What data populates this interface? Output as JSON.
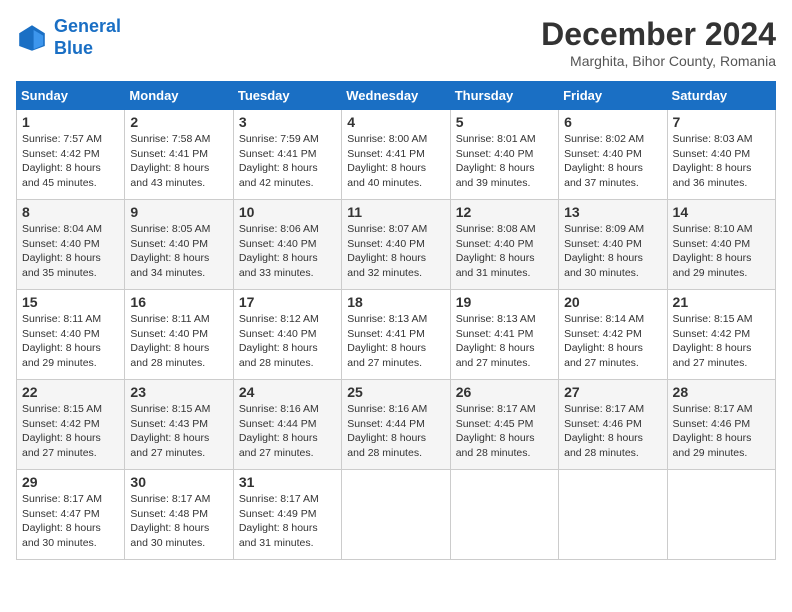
{
  "header": {
    "logo_line1": "General",
    "logo_line2": "Blue",
    "month": "December 2024",
    "location": "Marghita, Bihor County, Romania"
  },
  "days_of_week": [
    "Sunday",
    "Monday",
    "Tuesday",
    "Wednesday",
    "Thursday",
    "Friday",
    "Saturday"
  ],
  "weeks": [
    [
      {
        "day": "1",
        "info": "Sunrise: 7:57 AM\nSunset: 4:42 PM\nDaylight: 8 hours\nand 45 minutes."
      },
      {
        "day": "2",
        "info": "Sunrise: 7:58 AM\nSunset: 4:41 PM\nDaylight: 8 hours\nand 43 minutes."
      },
      {
        "day": "3",
        "info": "Sunrise: 7:59 AM\nSunset: 4:41 PM\nDaylight: 8 hours\nand 42 minutes."
      },
      {
        "day": "4",
        "info": "Sunrise: 8:00 AM\nSunset: 4:41 PM\nDaylight: 8 hours\nand 40 minutes."
      },
      {
        "day": "5",
        "info": "Sunrise: 8:01 AM\nSunset: 4:40 PM\nDaylight: 8 hours\nand 39 minutes."
      },
      {
        "day": "6",
        "info": "Sunrise: 8:02 AM\nSunset: 4:40 PM\nDaylight: 8 hours\nand 37 minutes."
      },
      {
        "day": "7",
        "info": "Sunrise: 8:03 AM\nSunset: 4:40 PM\nDaylight: 8 hours\nand 36 minutes."
      }
    ],
    [
      {
        "day": "8",
        "info": "Sunrise: 8:04 AM\nSunset: 4:40 PM\nDaylight: 8 hours\nand 35 minutes."
      },
      {
        "day": "9",
        "info": "Sunrise: 8:05 AM\nSunset: 4:40 PM\nDaylight: 8 hours\nand 34 minutes."
      },
      {
        "day": "10",
        "info": "Sunrise: 8:06 AM\nSunset: 4:40 PM\nDaylight: 8 hours\nand 33 minutes."
      },
      {
        "day": "11",
        "info": "Sunrise: 8:07 AM\nSunset: 4:40 PM\nDaylight: 8 hours\nand 32 minutes."
      },
      {
        "day": "12",
        "info": "Sunrise: 8:08 AM\nSunset: 4:40 PM\nDaylight: 8 hours\nand 31 minutes."
      },
      {
        "day": "13",
        "info": "Sunrise: 8:09 AM\nSunset: 4:40 PM\nDaylight: 8 hours\nand 30 minutes."
      },
      {
        "day": "14",
        "info": "Sunrise: 8:10 AM\nSunset: 4:40 PM\nDaylight: 8 hours\nand 29 minutes."
      }
    ],
    [
      {
        "day": "15",
        "info": "Sunrise: 8:11 AM\nSunset: 4:40 PM\nDaylight: 8 hours\nand 29 minutes."
      },
      {
        "day": "16",
        "info": "Sunrise: 8:11 AM\nSunset: 4:40 PM\nDaylight: 8 hours\nand 28 minutes."
      },
      {
        "day": "17",
        "info": "Sunrise: 8:12 AM\nSunset: 4:40 PM\nDaylight: 8 hours\nand 28 minutes."
      },
      {
        "day": "18",
        "info": "Sunrise: 8:13 AM\nSunset: 4:41 PM\nDaylight: 8 hours\nand 27 minutes."
      },
      {
        "day": "19",
        "info": "Sunrise: 8:13 AM\nSunset: 4:41 PM\nDaylight: 8 hours\nand 27 minutes."
      },
      {
        "day": "20",
        "info": "Sunrise: 8:14 AM\nSunset: 4:42 PM\nDaylight: 8 hours\nand 27 minutes."
      },
      {
        "day": "21",
        "info": "Sunrise: 8:15 AM\nSunset: 4:42 PM\nDaylight: 8 hours\nand 27 minutes."
      }
    ],
    [
      {
        "day": "22",
        "info": "Sunrise: 8:15 AM\nSunset: 4:42 PM\nDaylight: 8 hours\nand 27 minutes."
      },
      {
        "day": "23",
        "info": "Sunrise: 8:15 AM\nSunset: 4:43 PM\nDaylight: 8 hours\nand 27 minutes."
      },
      {
        "day": "24",
        "info": "Sunrise: 8:16 AM\nSunset: 4:44 PM\nDaylight: 8 hours\nand 27 minutes."
      },
      {
        "day": "25",
        "info": "Sunrise: 8:16 AM\nSunset: 4:44 PM\nDaylight: 8 hours\nand 28 minutes."
      },
      {
        "day": "26",
        "info": "Sunrise: 8:17 AM\nSunset: 4:45 PM\nDaylight: 8 hours\nand 28 minutes."
      },
      {
        "day": "27",
        "info": "Sunrise: 8:17 AM\nSunset: 4:46 PM\nDaylight: 8 hours\nand 28 minutes."
      },
      {
        "day": "28",
        "info": "Sunrise: 8:17 AM\nSunset: 4:46 PM\nDaylight: 8 hours\nand 29 minutes."
      }
    ],
    [
      {
        "day": "29",
        "info": "Sunrise: 8:17 AM\nSunset: 4:47 PM\nDaylight: 8 hours\nand 30 minutes."
      },
      {
        "day": "30",
        "info": "Sunrise: 8:17 AM\nSunset: 4:48 PM\nDaylight: 8 hours\nand 30 minutes."
      },
      {
        "day": "31",
        "info": "Sunrise: 8:17 AM\nSunset: 4:49 PM\nDaylight: 8 hours\nand 31 minutes."
      },
      {
        "day": "",
        "info": ""
      },
      {
        "day": "",
        "info": ""
      },
      {
        "day": "",
        "info": ""
      },
      {
        "day": "",
        "info": ""
      }
    ]
  ]
}
